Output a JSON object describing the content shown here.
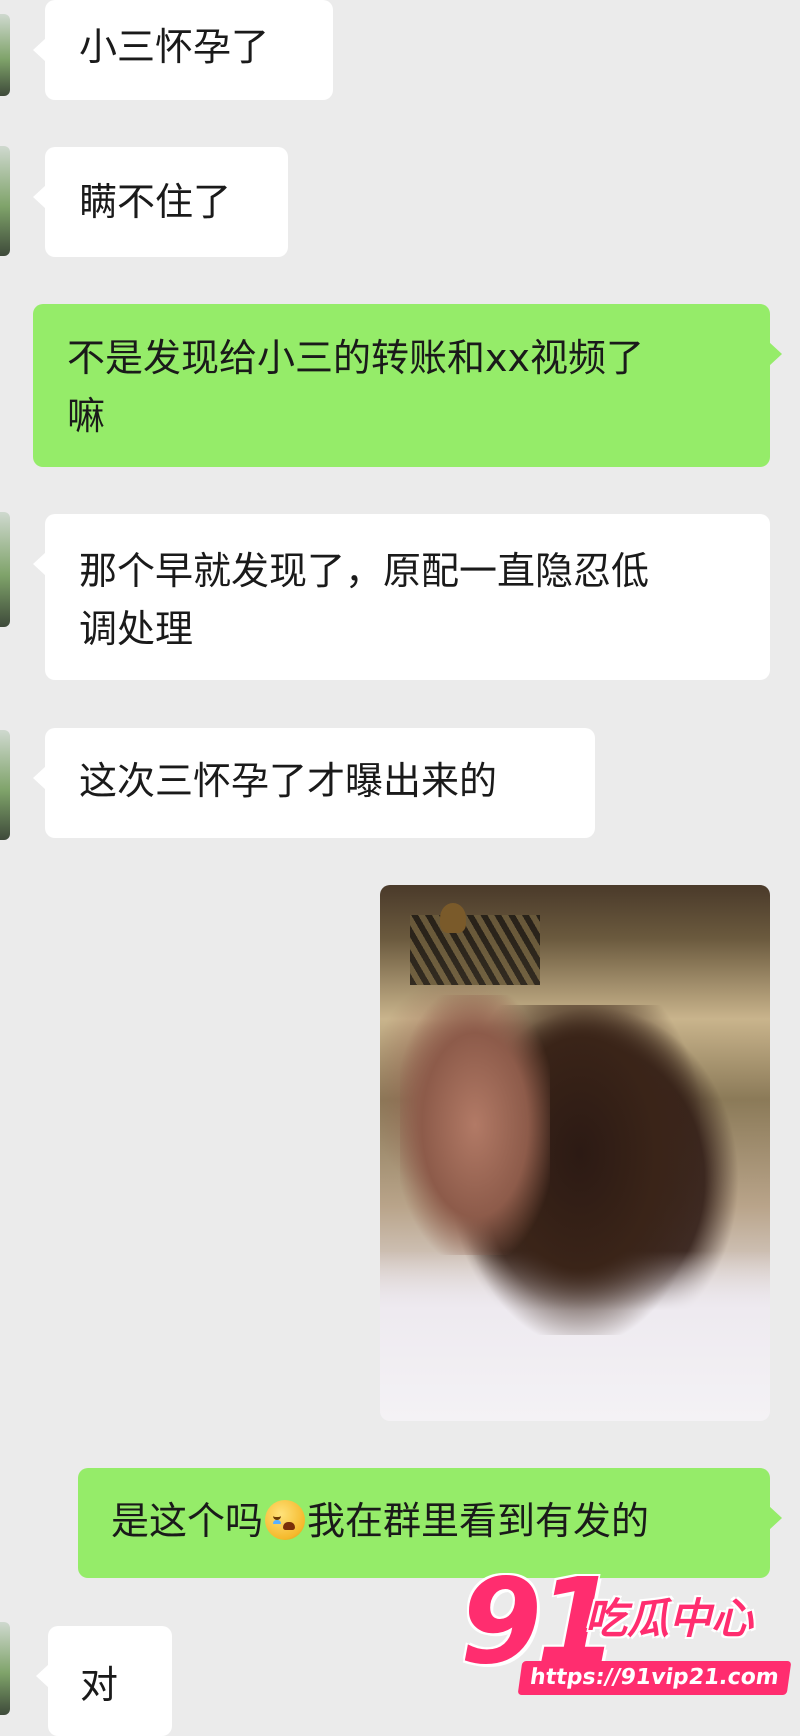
{
  "messages": [
    {
      "side": "in",
      "text": "小三怀孕了"
    },
    {
      "side": "in",
      "text": "瞒不住了"
    },
    {
      "side": "out",
      "text": "不是发现给小三的转账和xx视频了\n嘛"
    },
    {
      "side": "in",
      "text": "那个早就发现了，原配一直隐忍低\n调处理"
    },
    {
      "side": "in",
      "text": "这次三怀孕了才曝出来的"
    },
    {
      "side": "out",
      "type": "image"
    },
    {
      "side": "out",
      "text_before": "是这个吗",
      "emoji": "crying-face-emoji",
      "text_after": "我在群里看到有发的"
    },
    {
      "side": "in",
      "text": "对"
    }
  ],
  "watermark": {
    "number": "91",
    "brand": "吃瓜中心",
    "url": "https://91vip21.com"
  },
  "colors": {
    "background": "#ebebeb",
    "incoming_bubble": "#ffffff",
    "outgoing_bubble": "#95ec69",
    "watermark": "#ff2d6f"
  }
}
